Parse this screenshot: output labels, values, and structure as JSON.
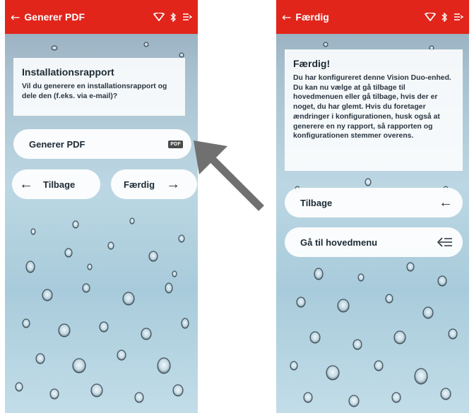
{
  "left": {
    "header": {
      "title": "Generer PDF"
    },
    "card": {
      "title": "Installationsrapport",
      "text": "Vil du generere en installationsrapport og dele den (f.eks. via e-mail)?"
    },
    "generate_button": {
      "label": "Generer PDF",
      "badge": "PDF"
    },
    "back_button": {
      "label": "Tilbage"
    },
    "done_button": {
      "label": "Færdig"
    }
  },
  "right": {
    "header": {
      "title": "Færdig"
    },
    "card": {
      "title": "Færdig!",
      "text": "Du har konfigureret denne Vision Duo-enhed. Du kan nu vælge at gå tilbage til hovedmenuen eller gå tilbage, hvis der er noget, du har glemt. Hvis du foretager ændringer i konfigurationen, husk også at generere en ny rapport, så rapporten og konfigurationen stemmer overens."
    },
    "back_button": {
      "label": "Tilbage"
    },
    "main_menu_button": {
      "label": "Gå til hovedmenu"
    }
  },
  "colors": {
    "header_red": "#e1251b",
    "pointer_gray": "#707070"
  },
  "icons": {
    "status": [
      "wifi-icon",
      "bluetooth-icon",
      "battery-icon"
    ],
    "pointer": "pointer-arrow-icon"
  }
}
